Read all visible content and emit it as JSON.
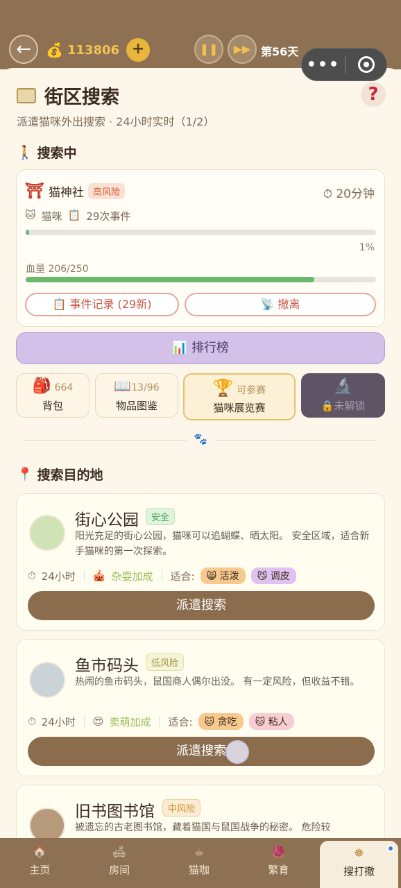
{
  "topbar": {
    "back_icon": "←",
    "coins": "113806",
    "add_icon": "+",
    "pause_icon": "❚❚",
    "fast_icon": "▶▶",
    "day": "第56天",
    "capsule_dots": "•••"
  },
  "header": {
    "title": "街区搜索",
    "help": "?",
    "subtitle": "派遣猫咪外出搜索 · 24小时实时（1/2）"
  },
  "searching": {
    "section_title": "搜索中",
    "location": "猫神社",
    "risk": "高风险",
    "timer": "20分钟",
    "cat": "猫咪",
    "events": "29次事件",
    "progress_pct": "1%",
    "progress_value": 0.01,
    "hp_label": "血量 206/250",
    "hp_value": 0.824,
    "event_log_button": "事件记录 (29新)",
    "retreat_button": "撤离"
  },
  "leaderboard_button": "排行榜",
  "tiles": {
    "backpack_count": "664",
    "backpack_label": "背包",
    "catalog_count": "13/96",
    "catalog_label": "物品图鉴",
    "expo_status": "可参赛",
    "expo_label": "猫咪展览赛",
    "locked_label": "未解锁"
  },
  "destinations_title": "搜索目的地",
  "destinations": [
    {
      "name": "街心公园",
      "risk": "安全",
      "desc": "阳光充足的街心公园，猫咪可以追蝴蝶、晒太阳。 安全区域，适合新手猫咪的第一次探索。",
      "duration": "24小时",
      "bonus": "杂耍加成",
      "suit_label": "适合:",
      "tag1": "活泼",
      "tag2": "调皮",
      "dispatch": "派遣搜索"
    },
    {
      "name": "鱼市码头",
      "risk": "低风险",
      "desc": "热闹的鱼市码头，鼠国商人偶尔出没。 有一定风险，但收益不错。",
      "duration": "24小时",
      "bonus": "卖萌加成",
      "suit_label": "适合:",
      "tag1": "贪吃",
      "tag2": "粘人",
      "dispatch": "派遣搜索"
    },
    {
      "name": "旧书图书馆",
      "risk": "中风险",
      "desc": "被遗忘的古老图书馆，藏着猫国与鼠国战争的秘密。 危险较"
    }
  ],
  "nav": [
    "主页",
    "房间",
    "猫咖",
    "繁育",
    "搜打撤"
  ]
}
